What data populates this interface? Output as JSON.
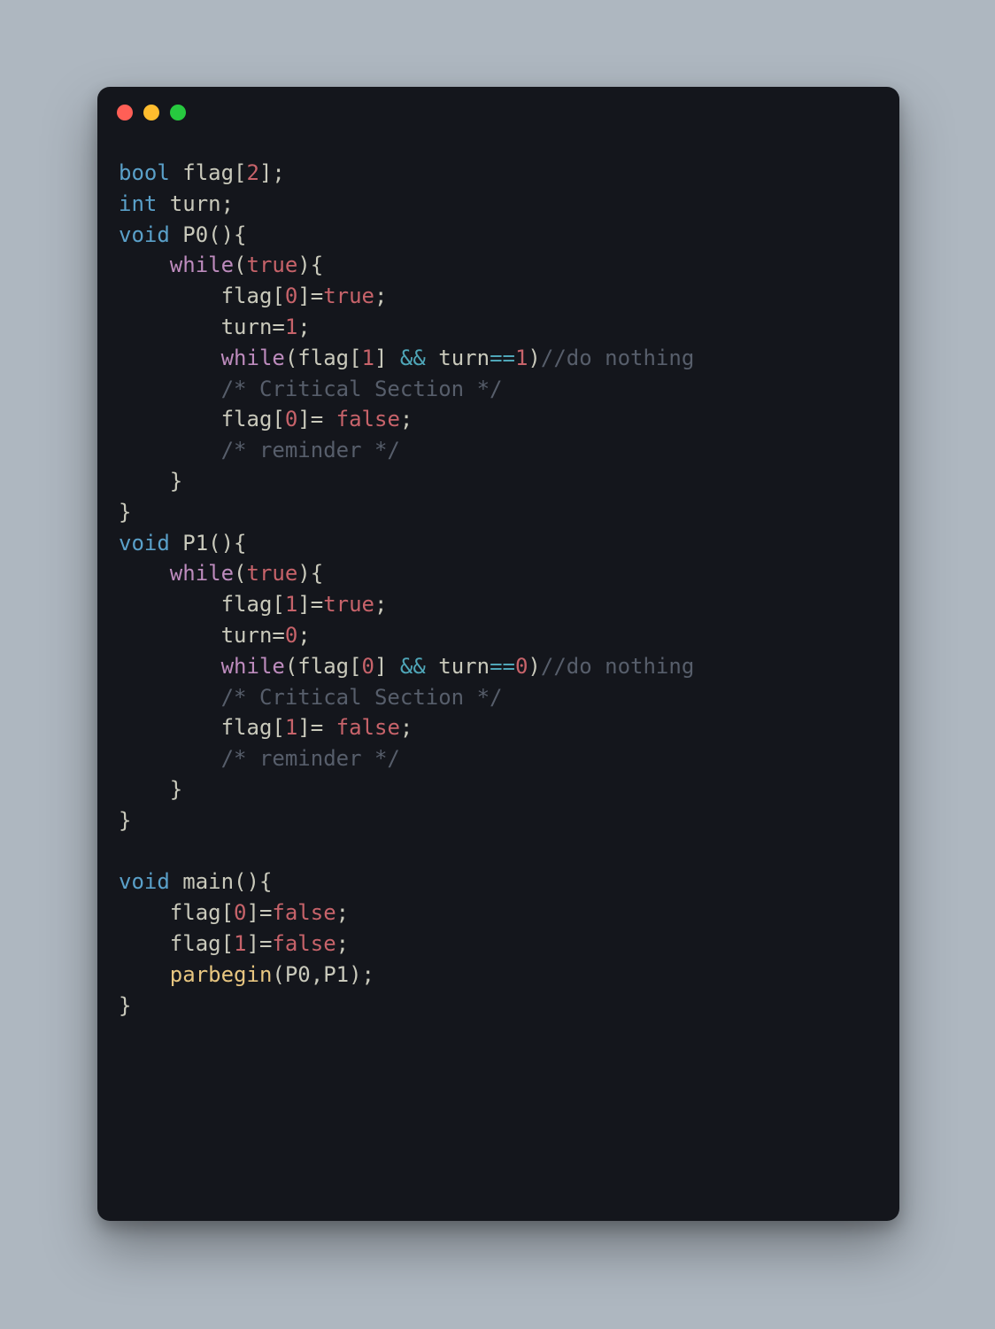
{
  "window": {
    "traffic_lights": [
      "close",
      "minimize",
      "maximize"
    ]
  },
  "code": {
    "lines": [
      [
        {
          "c": "c-type",
          "t": "bool"
        },
        {
          "c": "c-ident",
          "t": " flag["
        },
        {
          "c": "c-num",
          "t": "2"
        },
        {
          "c": "c-ident",
          "t": "];"
        }
      ],
      [
        {
          "c": "c-type",
          "t": "int"
        },
        {
          "c": "c-ident",
          "t": " turn;"
        }
      ],
      [
        {
          "c": "c-type",
          "t": "void"
        },
        {
          "c": "c-ident",
          "t": " P0(){"
        }
      ],
      [
        {
          "c": "c-ident",
          "t": "    "
        },
        {
          "c": "c-kw",
          "t": "while"
        },
        {
          "c": "c-ident",
          "t": "("
        },
        {
          "c": "c-num",
          "t": "true"
        },
        {
          "c": "c-ident",
          "t": "){"
        }
      ],
      [
        {
          "c": "c-ident",
          "t": "        flag["
        },
        {
          "c": "c-num",
          "t": "0"
        },
        {
          "c": "c-ident",
          "t": "]="
        },
        {
          "c": "c-num",
          "t": "true"
        },
        {
          "c": "c-ident",
          "t": ";"
        }
      ],
      [
        {
          "c": "c-ident",
          "t": "        turn="
        },
        {
          "c": "c-num",
          "t": "1"
        },
        {
          "c": "c-ident",
          "t": ";"
        }
      ],
      [
        {
          "c": "c-ident",
          "t": "        "
        },
        {
          "c": "c-kw",
          "t": "while"
        },
        {
          "c": "c-ident",
          "t": "(flag["
        },
        {
          "c": "c-num",
          "t": "1"
        },
        {
          "c": "c-ident",
          "t": "] "
        },
        {
          "c": "c-op",
          "t": "&&"
        },
        {
          "c": "c-ident",
          "t": " turn"
        },
        {
          "c": "c-op",
          "t": "=="
        },
        {
          "c": "c-num",
          "t": "1"
        },
        {
          "c": "c-ident",
          "t": ")"
        },
        {
          "c": "c-cmt",
          "t": "//do nothing"
        }
      ],
      [
        {
          "c": "c-ident",
          "t": "        "
        },
        {
          "c": "c-cmt",
          "t": "/* Critical Section */"
        }
      ],
      [
        {
          "c": "c-ident",
          "t": "        flag["
        },
        {
          "c": "c-num",
          "t": "0"
        },
        {
          "c": "c-ident",
          "t": "]= "
        },
        {
          "c": "c-num",
          "t": "false"
        },
        {
          "c": "c-ident",
          "t": ";"
        }
      ],
      [
        {
          "c": "c-ident",
          "t": "        "
        },
        {
          "c": "c-cmt",
          "t": "/* reminder */"
        }
      ],
      [
        {
          "c": "c-ident",
          "t": "    }"
        }
      ],
      [
        {
          "c": "c-ident",
          "t": "}"
        }
      ],
      [
        {
          "c": "c-type",
          "t": "void"
        },
        {
          "c": "c-ident",
          "t": " P1(){"
        }
      ],
      [
        {
          "c": "c-ident",
          "t": "    "
        },
        {
          "c": "c-kw",
          "t": "while"
        },
        {
          "c": "c-ident",
          "t": "("
        },
        {
          "c": "c-num",
          "t": "true"
        },
        {
          "c": "c-ident",
          "t": "){"
        }
      ],
      [
        {
          "c": "c-ident",
          "t": "        flag["
        },
        {
          "c": "c-num",
          "t": "1"
        },
        {
          "c": "c-ident",
          "t": "]="
        },
        {
          "c": "c-num",
          "t": "true"
        },
        {
          "c": "c-ident",
          "t": ";"
        }
      ],
      [
        {
          "c": "c-ident",
          "t": "        turn="
        },
        {
          "c": "c-num",
          "t": "0"
        },
        {
          "c": "c-ident",
          "t": ";"
        }
      ],
      [
        {
          "c": "c-ident",
          "t": "        "
        },
        {
          "c": "c-kw",
          "t": "while"
        },
        {
          "c": "c-ident",
          "t": "(flag["
        },
        {
          "c": "c-num",
          "t": "0"
        },
        {
          "c": "c-ident",
          "t": "] "
        },
        {
          "c": "c-op",
          "t": "&&"
        },
        {
          "c": "c-ident",
          "t": " turn"
        },
        {
          "c": "c-op",
          "t": "=="
        },
        {
          "c": "c-num",
          "t": "0"
        },
        {
          "c": "c-ident",
          "t": ")"
        },
        {
          "c": "c-cmt",
          "t": "//do nothing"
        }
      ],
      [
        {
          "c": "c-ident",
          "t": "        "
        },
        {
          "c": "c-cmt",
          "t": "/* Critical Section */"
        }
      ],
      [
        {
          "c": "c-ident",
          "t": "        flag["
        },
        {
          "c": "c-num",
          "t": "1"
        },
        {
          "c": "c-ident",
          "t": "]= "
        },
        {
          "c": "c-num",
          "t": "false"
        },
        {
          "c": "c-ident",
          "t": ";"
        }
      ],
      [
        {
          "c": "c-ident",
          "t": "        "
        },
        {
          "c": "c-cmt",
          "t": "/* reminder */"
        }
      ],
      [
        {
          "c": "c-ident",
          "t": "    }"
        }
      ],
      [
        {
          "c": "c-ident",
          "t": "}"
        }
      ],
      [
        {
          "c": "c-ident",
          "t": ""
        }
      ],
      [
        {
          "c": "c-type",
          "t": "void"
        },
        {
          "c": "c-ident",
          "t": " main(){"
        }
      ],
      [
        {
          "c": "c-ident",
          "t": "    flag["
        },
        {
          "c": "c-num",
          "t": "0"
        },
        {
          "c": "c-ident",
          "t": "]="
        },
        {
          "c": "c-num",
          "t": "false"
        },
        {
          "c": "c-ident",
          "t": ";"
        }
      ],
      [
        {
          "c": "c-ident",
          "t": "    flag["
        },
        {
          "c": "c-num",
          "t": "1"
        },
        {
          "c": "c-ident",
          "t": "]="
        },
        {
          "c": "c-num",
          "t": "false"
        },
        {
          "c": "c-ident",
          "t": ";"
        }
      ],
      [
        {
          "c": "c-ident",
          "t": "    "
        },
        {
          "c": "c-call",
          "t": "parbegin"
        },
        {
          "c": "c-ident",
          "t": "(P0,P1);"
        }
      ],
      [
        {
          "c": "c-ident",
          "t": "}"
        }
      ]
    ]
  }
}
